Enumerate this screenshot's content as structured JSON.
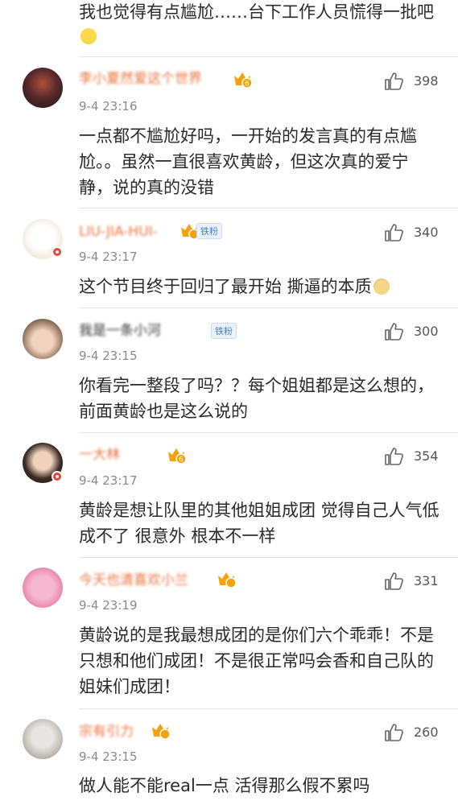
{
  "top_comment": {
    "text": "我也觉得有点尴尬……台下工作人员慌得一批吧",
    "emoji": "laughing-crying-emoji"
  },
  "comments": [
    {
      "username": "李小夏然爱这个世界",
      "time": "9-4 23:16",
      "likes": "398",
      "text": "一点都不尴尬好吗，一开始的发言真的有点尴尬。。虽然一直很喜欢黄龄，但这次真的爱宁静，说的真的没错",
      "level": "6",
      "tag": ""
    },
    {
      "username": "LIU-JIA-HUI-",
      "time": "9-4 23:17",
      "likes": "340",
      "text": "这个节目终于回归了最开始 撕逼的本质",
      "level": "",
      "tag": "铁粉"
    },
    {
      "username": "我是一条小河",
      "time": "9-4 23:15",
      "likes": "300",
      "text": "你看完一整段了吗？？每个姐姐都是这么想的，前面黄龄也是这么说的",
      "level": "",
      "tag": "铁粉"
    },
    {
      "username": "一大林",
      "time": "9-4 23:17",
      "likes": "354",
      "text": "黄龄是想让队里的其他姐姐成团 觉得自己人气低成不了 很意外 根本不一样",
      "level": "6",
      "tag": ""
    },
    {
      "username": "今天也清喜欢小兰",
      "time": "9-4 23:19",
      "likes": "331",
      "text": "黄龄说的是我最想成团的是你们六个乖乖！不是只想和他们成团！不是很正常吗会香和自己队的姐妹们成团！",
      "level": "",
      "tag": ""
    },
    {
      "username": "宗有引力",
      "time": "9-4 23:15",
      "likes": "260",
      "text": "做人能不能real一点 活得那么假不累吗",
      "level": "",
      "tag": ""
    }
  ],
  "colors": {
    "username": "#e8703a",
    "time": "#8a8a8a",
    "text": "#2a2a2a",
    "divider": "#e4e4e4",
    "verified_badge": "#e8463c",
    "level_badge": "#f2a30f"
  }
}
